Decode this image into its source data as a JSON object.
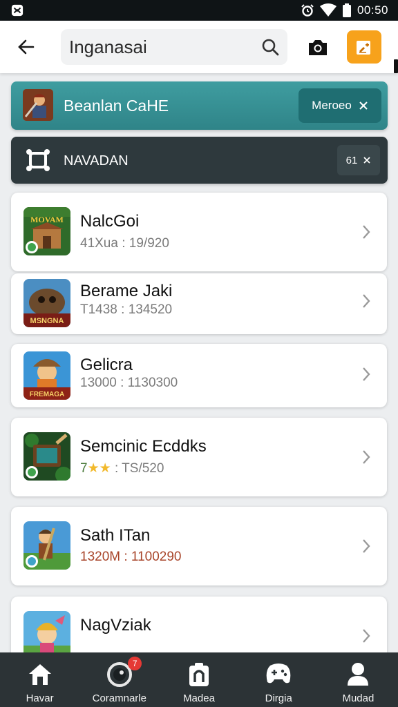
{
  "status_bar": {
    "time": "00:50",
    "icons": [
      "app-logo-icon",
      "alarm-icon",
      "wifi-icon",
      "battery-icon"
    ]
  },
  "app_bar": {
    "back_icon": "arrow-left-icon",
    "search": {
      "value": "Inganasai",
      "placeholder": ""
    },
    "search_icon": "search-icon",
    "camera_icon": "camera-icon",
    "edit_icon": "edit-note-icon",
    "accent": "#f7a21b"
  },
  "banners": {
    "promo": {
      "title": "Beanlan CaHE",
      "action_label": "Meroeo",
      "color": "#3a9598"
    },
    "secondary": {
      "title": "NAVADAN",
      "action_label": "61",
      "color": "#2e393d"
    }
  },
  "games": [
    {
      "name": "NalcGoi",
      "meta": "41Xua : 19/920",
      "thumb_text": "MOVAM"
    },
    {
      "name": "Berame Jaki",
      "meta": "T1438 : 134520",
      "thumb_text": "MSNGNA"
    },
    {
      "name": "Gelicra",
      "meta": "13000 : 1130300",
      "thumb_text": "FREMAGA"
    },
    {
      "name": "Semcinic Ecddks",
      "meta_prefix": "7",
      "meta_suffix": " : TS/520",
      "rating_stars": 2
    },
    {
      "name": "Sath ITan",
      "meta": "1320M : 1100290",
      "meta_color": "#b23a2a"
    },
    {
      "name": "NagVziak",
      "meta": ""
    }
  ],
  "bottom_nav": [
    {
      "label": "Havar",
      "icon": "home-icon"
    },
    {
      "label": "Coramnarle",
      "icon": "record-icon",
      "badge": "7"
    },
    {
      "label": "Madea",
      "icon": "media-icon"
    },
    {
      "label": "Dirgia",
      "icon": "controller-icon"
    },
    {
      "label": "Mudad",
      "icon": "profile-icon"
    }
  ]
}
